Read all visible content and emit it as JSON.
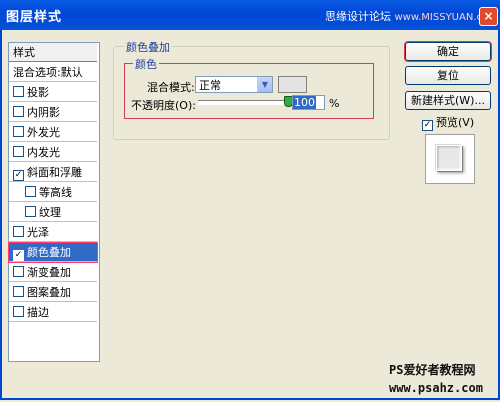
{
  "window": {
    "title": "图层样式",
    "watermark_site": "思缘设计论坛",
    "watermark_url": "www.MISSYUAN.com",
    "close_glyph": "×"
  },
  "sidebar": {
    "header": "样式",
    "items": [
      {
        "label": "混合选项:默认",
        "has_checkbox": false,
        "checked": false
      },
      {
        "label": "投影",
        "has_checkbox": true,
        "checked": false
      },
      {
        "label": "内阴影",
        "has_checkbox": true,
        "checked": false
      },
      {
        "label": "外发光",
        "has_checkbox": true,
        "checked": false
      },
      {
        "label": "内发光",
        "has_checkbox": true,
        "checked": false
      },
      {
        "label": "斜面和浮雕",
        "has_checkbox": true,
        "checked": true
      },
      {
        "label": "等高线",
        "has_checkbox": true,
        "checked": false
      },
      {
        "label": "纹理",
        "has_checkbox": true,
        "checked": false
      },
      {
        "label": "光泽",
        "has_checkbox": true,
        "checked": false
      },
      {
        "label": "颜色叠加",
        "has_checkbox": true,
        "checked": true,
        "selected": true
      },
      {
        "label": "渐变叠加",
        "has_checkbox": true,
        "checked": false
      },
      {
        "label": "图案叠加",
        "has_checkbox": true,
        "checked": false
      },
      {
        "label": "描边",
        "has_checkbox": true,
        "checked": false
      }
    ]
  },
  "main": {
    "section_title": "颜色叠加",
    "group_title": "颜色",
    "blend_mode_label": "混合模式:",
    "blend_mode_value": "正常",
    "opacity_label": "不透明度(O):",
    "opacity_value": "100",
    "opacity_unit": "%",
    "overlay_color": "#e4e4e4"
  },
  "buttons": {
    "ok": "确定",
    "reset": "复位",
    "new_style": "新建样式(W)...",
    "preview_label": "预览(V)",
    "preview_checked": true
  },
  "footer": {
    "watermark_line1": "PS爱好者教程网",
    "watermark_line2": "www.psahz.com"
  },
  "colors": {
    "titlebar": "#0046d5",
    "selected": "#316ac5",
    "highlight_outline": "#e3384e",
    "slider_thumb": "#2fae3c"
  }
}
